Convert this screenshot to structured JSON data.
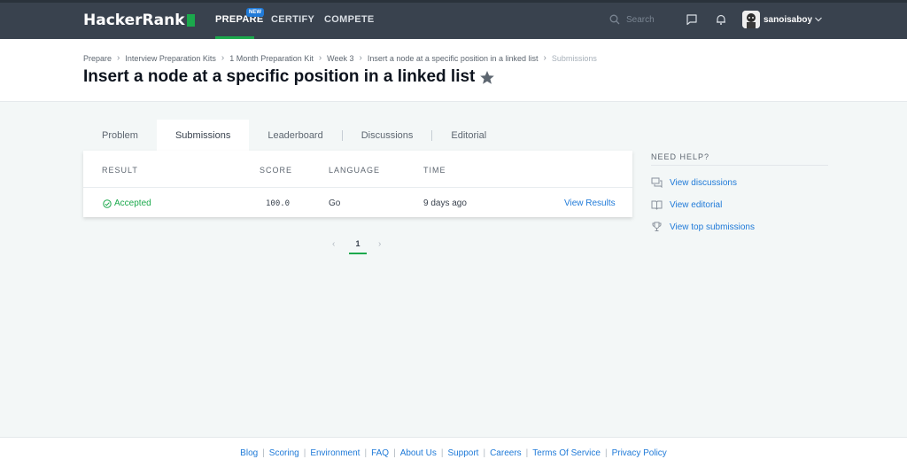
{
  "nav": {
    "logo": "HackerRank",
    "items": [
      "PREPARE",
      "CERTIFY",
      "COMPETE"
    ],
    "new_badge": "NEW",
    "search_placeholder": "Search",
    "username": "sanoisaboy"
  },
  "breadcrumb": [
    "Prepare",
    "Interview Preparation Kits",
    "1 Month Preparation Kit",
    "Week 3",
    "Insert a node at a specific position in a linked list",
    "Submissions"
  ],
  "page_title": "Insert a node at a specific position in a linked list",
  "tabs": [
    "Problem",
    "Submissions",
    "Leaderboard",
    "Discussions",
    "Editorial"
  ],
  "active_tab": "Submissions",
  "table": {
    "headers": [
      "RESULT",
      "SCORE",
      "LANGUAGE",
      "TIME"
    ],
    "rows": [
      {
        "result": "Accepted",
        "score": "100.0",
        "language": "Go",
        "time": "9 days ago",
        "action": "View Results"
      }
    ]
  },
  "pagination": {
    "current": "1",
    "prev": "‹",
    "next": "›"
  },
  "help": {
    "title": "NEED HELP?",
    "links": [
      "View discussions",
      "View editorial",
      "View top submissions"
    ]
  },
  "footer": [
    "Blog",
    "Scoring",
    "Environment",
    "FAQ",
    "About Us",
    "Support",
    "Careers",
    "Terms Of Service",
    "Privacy Policy"
  ],
  "colors": {
    "nav_bg": "#39424e",
    "accent_green": "#1ba94c",
    "link_blue": "#1f7ad8",
    "page_bg": "#f3f7f7"
  }
}
